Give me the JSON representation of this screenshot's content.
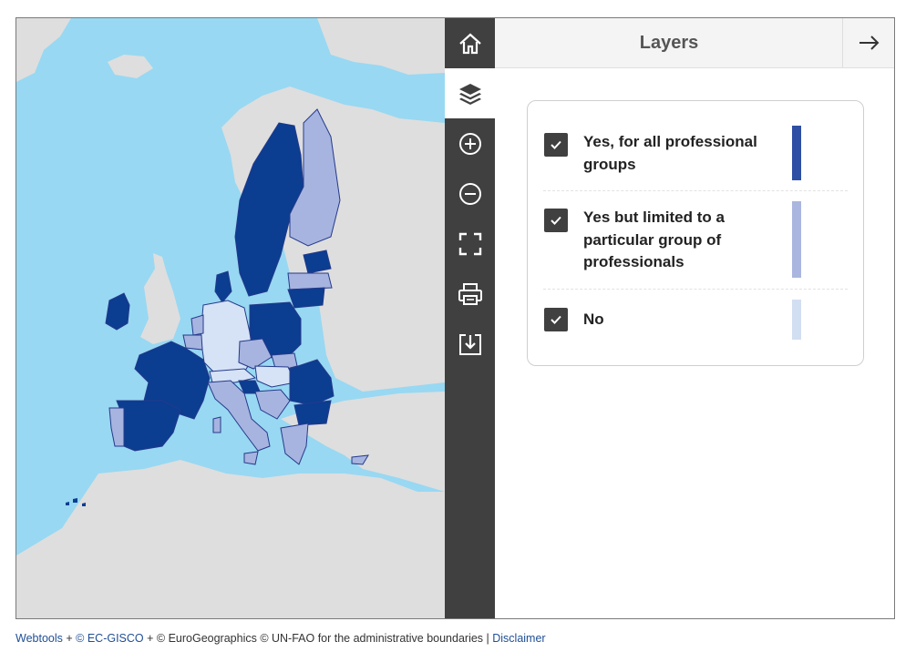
{
  "panel": {
    "title": "Layers"
  },
  "toolbar": {
    "items": [
      {
        "icon": "home-icon",
        "active": false
      },
      {
        "icon": "layers-icon",
        "active": true
      },
      {
        "icon": "zoom-in-icon",
        "active": false
      },
      {
        "icon": "zoom-out-icon",
        "active": false
      },
      {
        "icon": "fullscreen-icon",
        "active": false
      },
      {
        "icon": "print-icon",
        "active": false
      },
      {
        "icon": "download-icon",
        "active": false
      }
    ]
  },
  "legend": {
    "items": [
      {
        "label": "Yes, for all professional groups",
        "checked": true,
        "color": "#2e4fa3"
      },
      {
        "label": "Yes but limited to a particular group of professionals",
        "checked": true,
        "color": "#aab6df"
      },
      {
        "label": "No",
        "checked": true,
        "color": "#d2def2"
      }
    ]
  },
  "colors": {
    "sea": "#98d8f2",
    "land": "#dedede",
    "yes_all": "#0b3d91",
    "yes_limited": "#a7b4e0",
    "no": "#d6e2f6",
    "toolbar": "#404040"
  },
  "footer": {
    "webtools": "Webtools",
    "sep1": " + ",
    "gisco": "© EC-GISCO",
    "rest": " + © EuroGeographics © UN-FAO for the administrative boundaries | ",
    "disclaimer": "Disclaimer"
  }
}
